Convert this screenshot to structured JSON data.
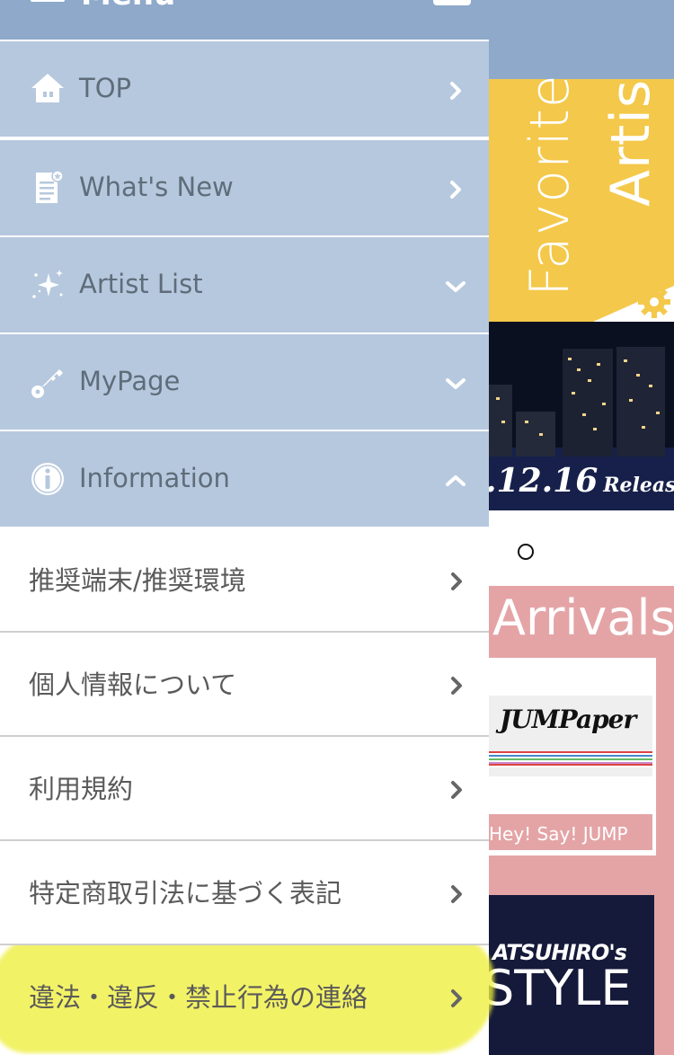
{
  "menu": {
    "title": "Menu",
    "nav_items": [
      {
        "label": "TOP",
        "icon": "home-icon",
        "arrow": "chevron-right-icon"
      },
      {
        "label": "What's New",
        "icon": "news-icon",
        "arrow": "chevron-right-icon"
      },
      {
        "label": "Artist List",
        "icon": "sparkle-icon",
        "arrow": "chevron-down-icon"
      },
      {
        "label": "MyPage",
        "icon": "key-icon",
        "arrow": "chevron-down-icon"
      },
      {
        "label": "Information",
        "icon": "info-icon",
        "arrow": "chevron-up-icon"
      }
    ],
    "info_sub_items": [
      {
        "label": "推奨端末/推奨環境"
      },
      {
        "label": "個人情報について"
      },
      {
        "label": "利用規約"
      },
      {
        "label": "特定商取引法に基づく表記"
      },
      {
        "label": "違法・違反・禁止行為の連絡"
      }
    ]
  },
  "background": {
    "favorite_text_1": "Favorite",
    "favorite_text_2": "Artis",
    "release_date": ".12.16",
    "release_word": "Release",
    "section_title": "Arrivals",
    "card1_title": "JUMPaper",
    "card1_artist": "Hey! Say! JUMP",
    "card2_line1": "ATSUHIRO's",
    "card2_line2": "STYLE"
  },
  "colors": {
    "menu_header": "#8ea9c9",
    "nav_item_bg": "#b6c8de",
    "sub_item_bg": "#ffffff",
    "favorite_banner": "#f4c84a",
    "arrivals_bg": "#e4a4a6",
    "highlight": "#eeee3c"
  }
}
